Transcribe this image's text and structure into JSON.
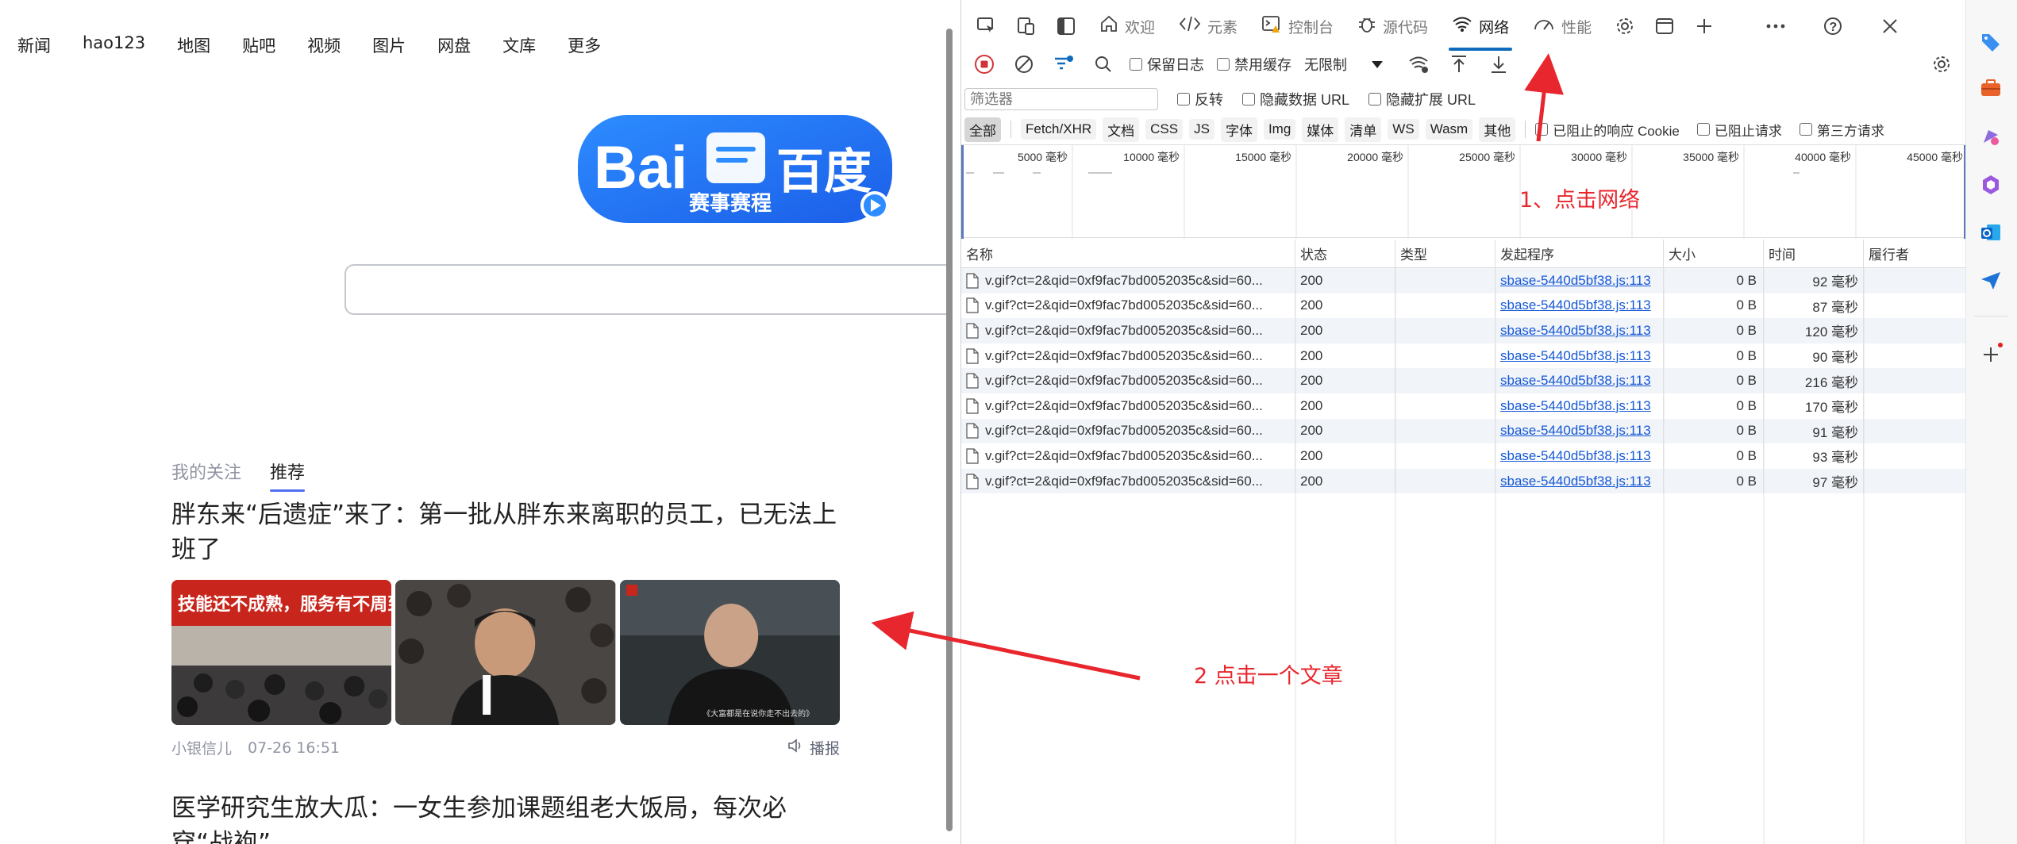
{
  "baidu": {
    "nav": [
      "新闻",
      "hao123",
      "地图",
      "贴吧",
      "视频",
      "图片",
      "网盘",
      "文库",
      "更多"
    ],
    "logo": {
      "text_left": "Bai",
      "text_right": "百度",
      "sub": "赛事赛程"
    },
    "feed_tabs": {
      "following": "我的关注",
      "recommend": "推荐"
    },
    "article1": {
      "title": "胖东来“后遗症”来了：第一批从胖东来离职的员工，已无法上班了",
      "image1_banner": "技能还不成熟，服务有不周到的地",
      "image3_caption": "《大富都是在说你走不出去的》",
      "author": "小银信儿",
      "time": "07-26 16:51",
      "play": "播报"
    },
    "article2": {
      "title": "医学研究生放大瓜：一女生参加课题组老大饭局，每次必穿“战袍”"
    }
  },
  "devtools": {
    "tabs": [
      {
        "label": "欢迎",
        "icon": "home-icon"
      },
      {
        "label": "元素",
        "icon": "code-icon"
      },
      {
        "label": "控制台",
        "icon": "console-icon"
      },
      {
        "label": "源代码",
        "icon": "bug-icon"
      },
      {
        "label": "网络",
        "icon": "wifi-icon",
        "active": true
      },
      {
        "label": "性能",
        "icon": "gauge-icon"
      }
    ],
    "row2": {
      "preserve_log": "保留日志",
      "disable_cache": "禁用缓存",
      "throttle": "无限制"
    },
    "row3": {
      "filter_placeholder": "筛选器",
      "invert": "反转",
      "hide_data_urls": "隐藏数据 URL",
      "hide_ext_urls": "隐藏扩展 URL"
    },
    "row4": {
      "types": [
        "全部",
        "Fetch/XHR",
        "文档",
        "CSS",
        "JS",
        "字体",
        "Img",
        "媒体",
        "清单",
        "WS",
        "Wasm",
        "其他"
      ],
      "blocked_cookies": "已阻止的响应 Cookie",
      "blocked_requests": "已阻止请求",
      "third_party": "第三方请求"
    },
    "timeline_ticks": [
      "5000 毫秒",
      "10000 毫秒",
      "15000 毫秒",
      "20000 毫秒",
      "25000 毫秒",
      "30000 毫秒",
      "35000 毫秒",
      "40000 毫秒",
      "45000 毫秒"
    ],
    "table": {
      "headers": [
        "名称",
        "状态",
        "类型",
        "发起程序",
        "大小",
        "时间",
        "履行者"
      ],
      "rows": [
        {
          "name": "v.gif?ct=2&qid=0xf9fac7bd0052035c&sid=60...",
          "status": "200",
          "type": "",
          "initiator": "sbase-5440d5bf38.js:113",
          "size": "0 B",
          "time": "92 毫秒"
        },
        {
          "name": "v.gif?ct=2&qid=0xf9fac7bd0052035c&sid=60...",
          "status": "200",
          "type": "",
          "initiator": "sbase-5440d5bf38.js:113",
          "size": "0 B",
          "time": "87 毫秒"
        },
        {
          "name": "v.gif?ct=2&qid=0xf9fac7bd0052035c&sid=60...",
          "status": "200",
          "type": "",
          "initiator": "sbase-5440d5bf38.js:113",
          "size": "0 B",
          "time": "120 毫秒"
        },
        {
          "name": "v.gif?ct=2&qid=0xf9fac7bd0052035c&sid=60...",
          "status": "200",
          "type": "",
          "initiator": "sbase-5440d5bf38.js:113",
          "size": "0 B",
          "time": "90 毫秒"
        },
        {
          "name": "v.gif?ct=2&qid=0xf9fac7bd0052035c&sid=60...",
          "status": "200",
          "type": "",
          "initiator": "sbase-5440d5bf38.js:113",
          "size": "0 B",
          "time": "216 毫秒"
        },
        {
          "name": "v.gif?ct=2&qid=0xf9fac7bd0052035c&sid=60...",
          "status": "200",
          "type": "",
          "initiator": "sbase-5440d5bf38.js:113",
          "size": "0 B",
          "time": "170 毫秒"
        },
        {
          "name": "v.gif?ct=2&qid=0xf9fac7bd0052035c&sid=60...",
          "status": "200",
          "type": "",
          "initiator": "sbase-5440d5bf38.js:113",
          "size": "0 B",
          "time": "91 毫秒"
        },
        {
          "name": "v.gif?ct=2&qid=0xf9fac7bd0052035c&sid=60...",
          "status": "200",
          "type": "",
          "initiator": "sbase-5440d5bf38.js:113",
          "size": "0 B",
          "time": "93 毫秒"
        },
        {
          "name": "v.gif?ct=2&qid=0xf9fac7bd0052035c&sid=60...",
          "status": "200",
          "type": "",
          "initiator": "sbase-5440d5bf38.js:113",
          "size": "0 B",
          "time": "97 毫秒"
        }
      ]
    }
  },
  "annotations": {
    "step1": "1、点击网络",
    "step2": "2 点击一个文章",
    "color": "#e8262d"
  }
}
